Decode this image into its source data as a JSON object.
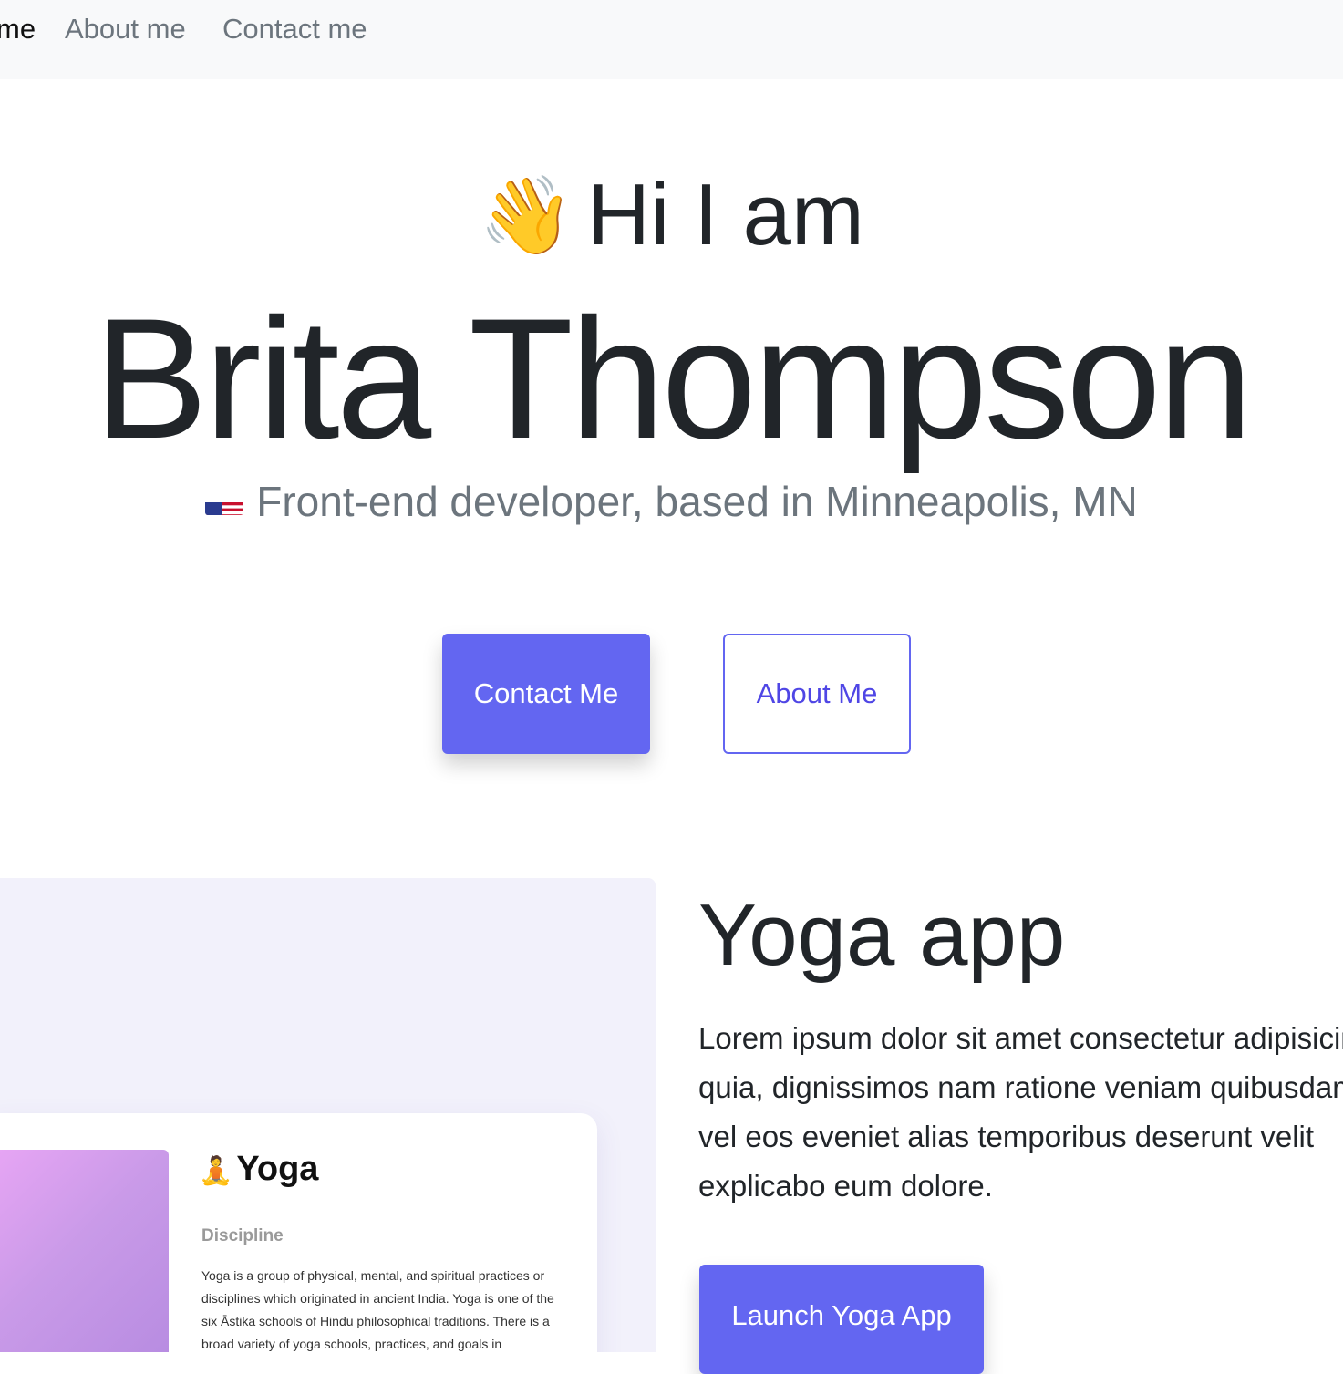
{
  "nav": {
    "items": [
      {
        "label": "me"
      },
      {
        "label": "About me"
      },
      {
        "label": "Contact me"
      }
    ]
  },
  "hero": {
    "wave_emoji": "👋",
    "greeting": "Hi I am",
    "name": "Brita Thompson",
    "tagline": "Front-end developer, based in Minneapolis, MN",
    "contact_button": "Contact Me",
    "about_button": "About Me"
  },
  "project": {
    "title": "Yoga app",
    "description_lines": [
      "Lorem ipsum dolor sit amet consectetur adipisicing elit. Quas",
      "quia, dignissimos nam ratione veniam quibusdam",
      "vel eos eveniet alias temporibus deserunt velit",
      "explicabo eum dolore."
    ],
    "launch_button": "Launch Yoga App",
    "preview": {
      "meditate_emoji": "🧘",
      "heading": "Yoga",
      "subheading": "Discipline",
      "description": "Yoga is a group of physical, mental, and spiritual practices or disciplines which originated in ancient India. Yoga is one of the six Āstika schools of Hindu philosophical traditions. There is a broad variety of yoga schools, practices, and goals in"
    }
  },
  "colors": {
    "accent": "#6366f1",
    "nav_bg": "#f8f9fa",
    "muted_text": "#6c757d",
    "project_panel_bg": "#f2f1fb"
  }
}
